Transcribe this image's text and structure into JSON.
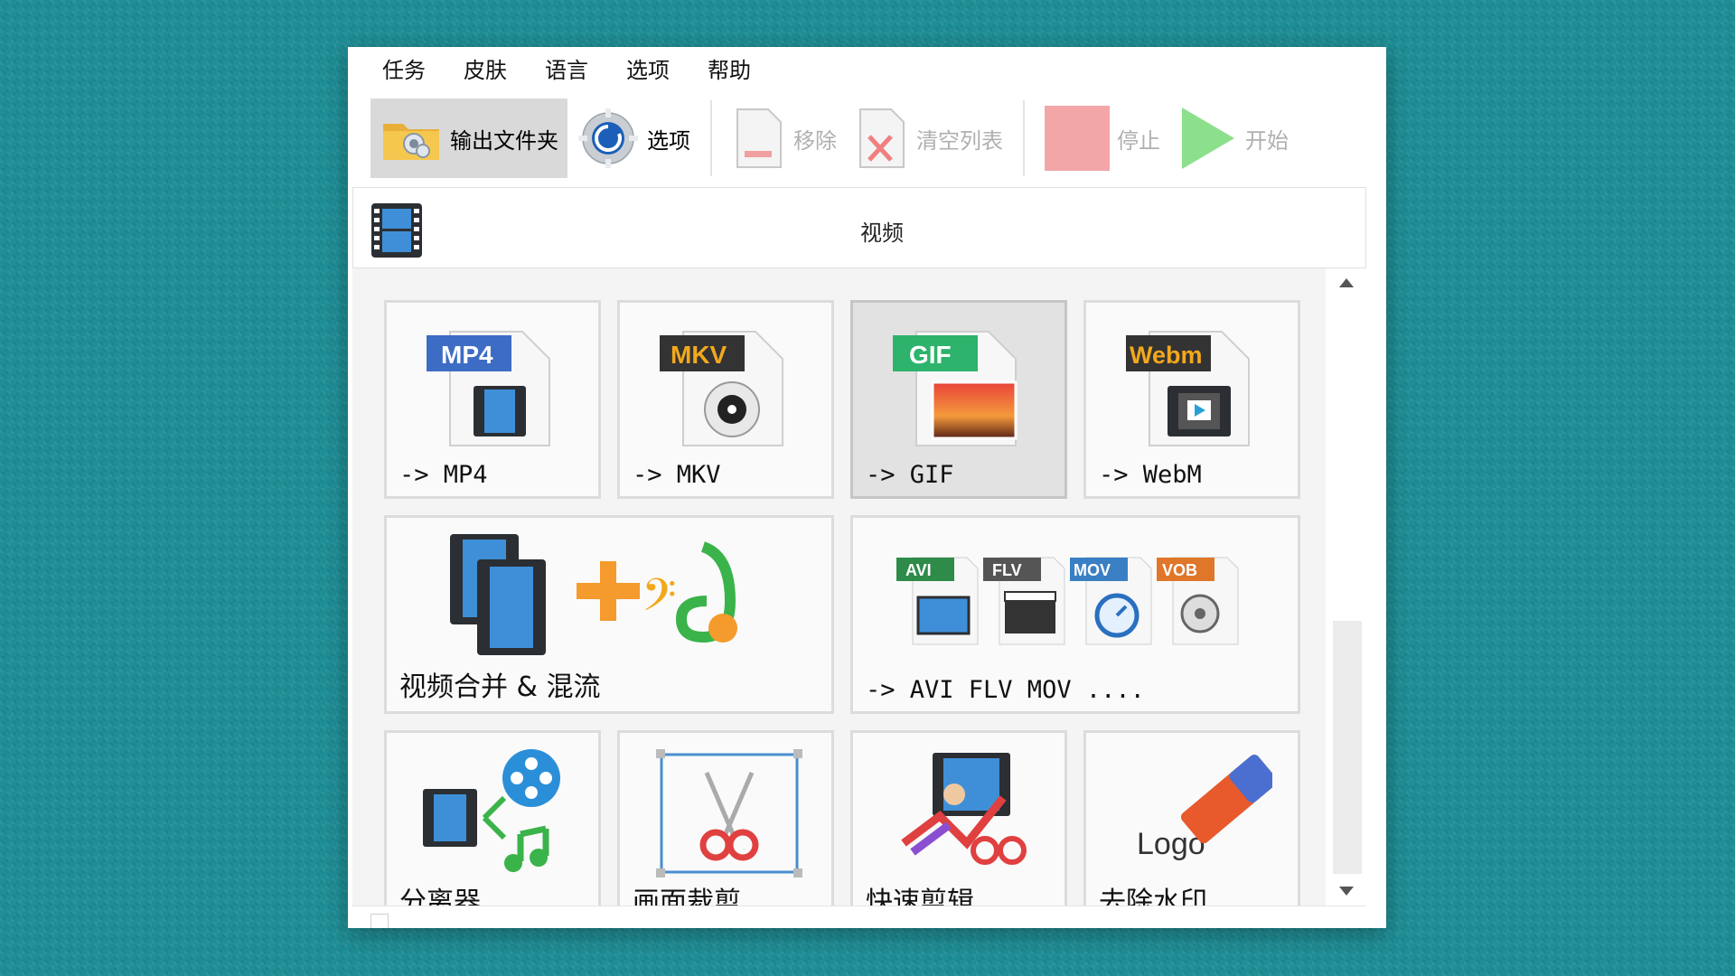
{
  "menu": [
    "任务",
    "皮肤",
    "语言",
    "选项",
    "帮助"
  ],
  "toolbar": {
    "output_folder": "输出文件夹",
    "options": "选项",
    "remove": "移除",
    "clear_list": "清空列表",
    "stop": "停止",
    "start": "开始"
  },
  "section": {
    "title": "视频"
  },
  "tiles": [
    {
      "label": "-> MP4",
      "badge": "MP4"
    },
    {
      "label": "-> MKV",
      "badge": "MKV"
    },
    {
      "label": "-> GIF",
      "badge": "GIF"
    },
    {
      "label": "-> WebM",
      "badge": "Webm"
    },
    {
      "label": "视频合并 & 混流"
    },
    {
      "label": "-> AVI FLV MOV ....",
      "badges": [
        "AVI",
        "FLV",
        "MOV",
        "VOB"
      ]
    },
    {
      "label": "分离器"
    },
    {
      "label": "画面裁剪"
    },
    {
      "label": "快速剪辑"
    },
    {
      "label": "去除水印",
      "logo_text": "Logo"
    }
  ],
  "colors": {
    "background": "#1f8e96",
    "badge_mp4": "#3d6cc4",
    "badge_mkv": "#333333",
    "badge_mkv_text": "#f2a81d",
    "badge_gif": "#2db36b",
    "badge_webm": "#333333",
    "badge_webm_text": "#f2a81d",
    "stop": "#f2a6a8",
    "start": "#8ce08c"
  }
}
